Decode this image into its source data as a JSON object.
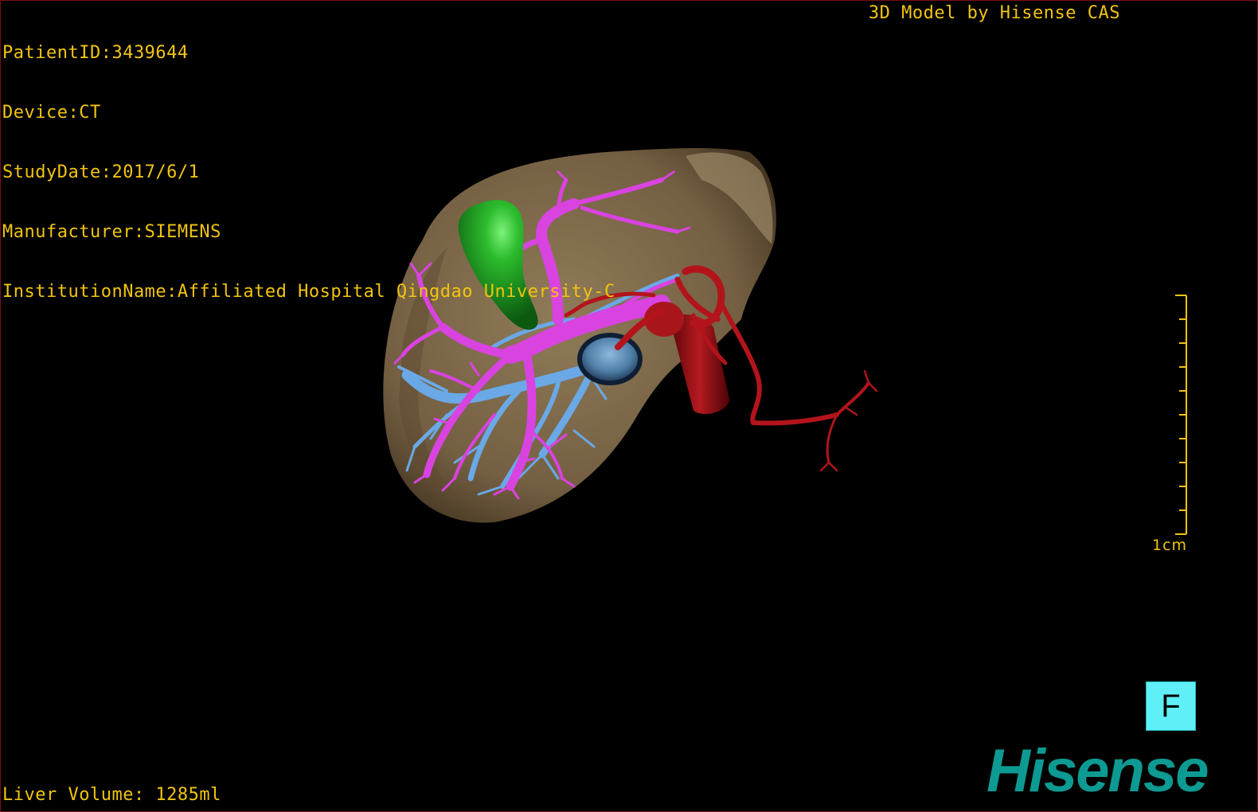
{
  "study": {
    "patient_id": "PatientID:3439644",
    "device": "Device:CT",
    "study_date": "StudyDate:2017/6/1",
    "manufacturer": "Manufacturer:SIEMENS",
    "institution": "InstitutionName:Affiliated Hospital Qingdao University-C"
  },
  "watermark": "3D Model by Hisense CAS",
  "liver_volume": "Liver Volume: 1285ml",
  "scale": {
    "label": "1cm",
    "ticks": 10
  },
  "orientation": {
    "label": "F"
  },
  "brand": "Hisense",
  "model": {
    "structures": [
      {
        "name": "liver",
        "color": "#8b7352"
      },
      {
        "name": "gallbladder",
        "color": "#1f9a24"
      },
      {
        "name": "portal-vein",
        "color": "#d943e0"
      },
      {
        "name": "hepatic-vein",
        "color": "#6aa8e6"
      },
      {
        "name": "lesion",
        "color": "#3f6c94"
      },
      {
        "name": "artery",
        "color": "#b3141c"
      }
    ]
  },
  "colors": {
    "overlay_text": "#f1c40f",
    "orientation_bg": "#5ff0f7",
    "brand": "#0d9a92",
    "border": "#7a0f14"
  }
}
